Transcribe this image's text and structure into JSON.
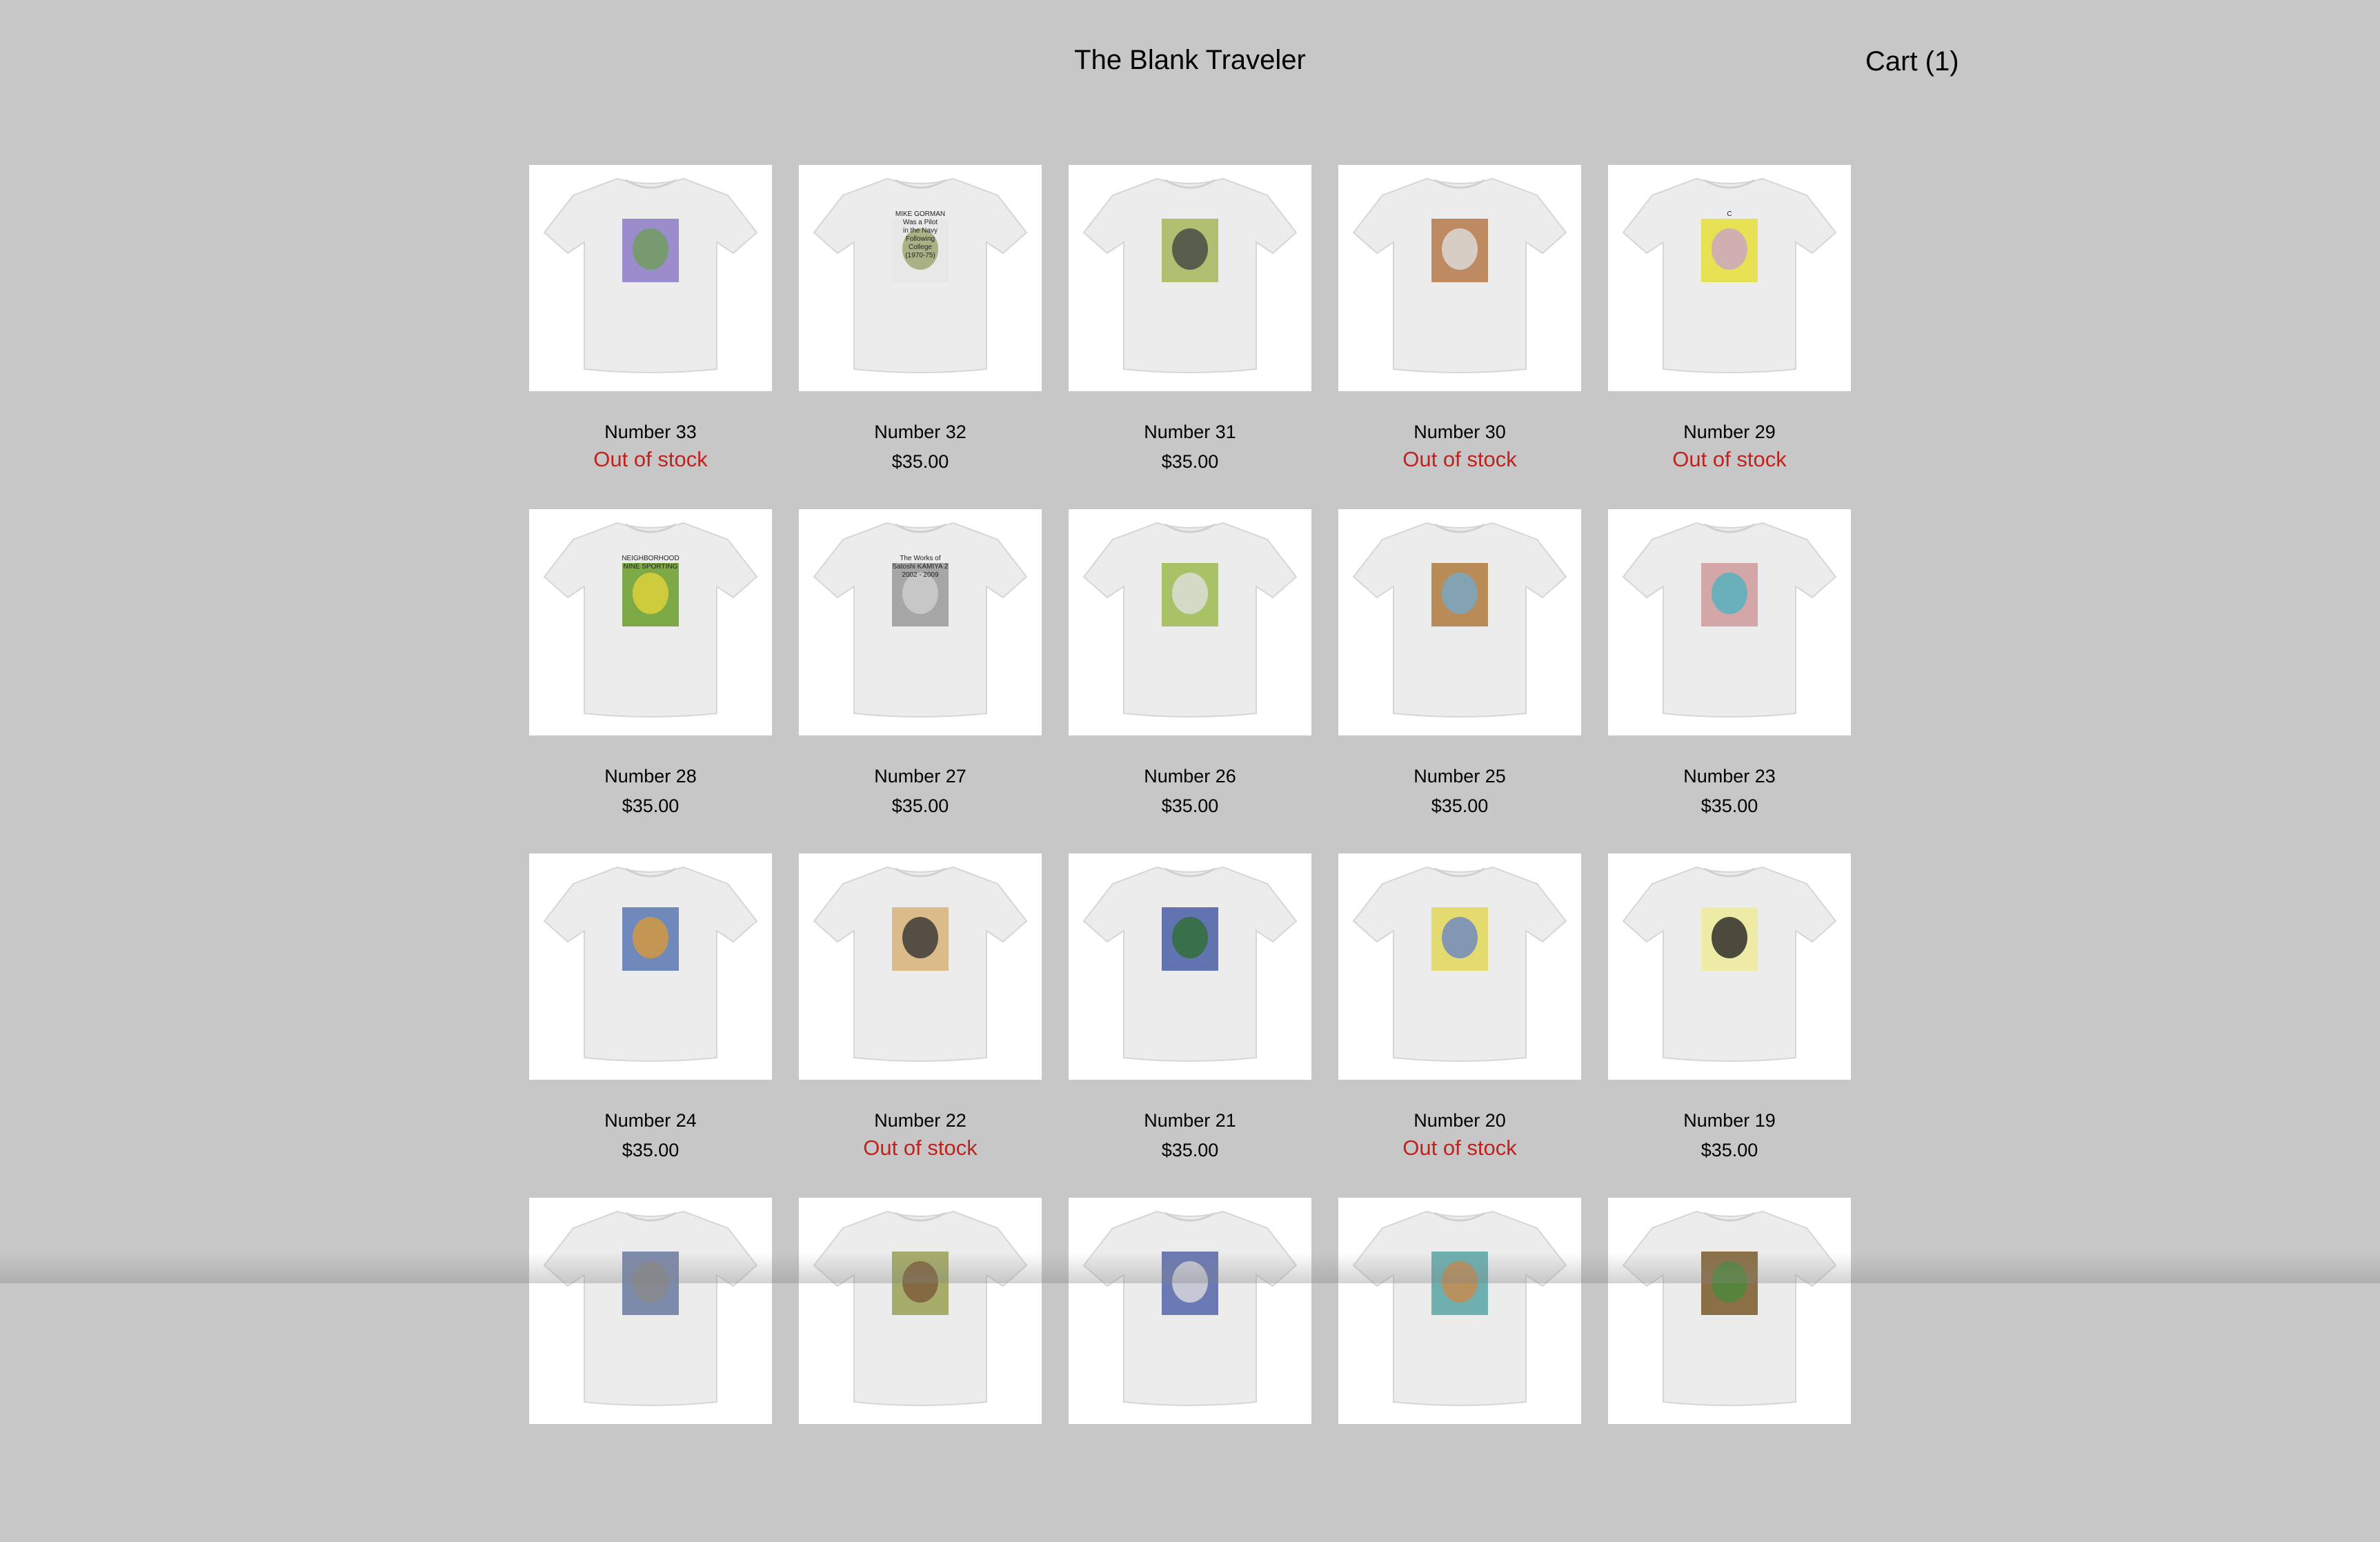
{
  "header": {
    "title": "The Blank Traveler",
    "cart_label": "Cart (1)"
  },
  "colors": {
    "page_background": "#c7c7c7",
    "card_background": "#ffffff",
    "out_of_stock": "#c0231d",
    "text": "#000000"
  },
  "products": [
    {
      "name": "Number 33",
      "price": "Out of stock",
      "sold_out": true,
      "graphic": "purple-figure-print"
    },
    {
      "name": "Number 32",
      "price": "$35.00",
      "sold_out": false,
      "graphic": "mike-gorman-text-print",
      "print_text": [
        "MIKE GORMAN",
        "Was a Pilot",
        "in the Navy",
        "Following",
        "College",
        "(1970-75)"
      ]
    },
    {
      "name": "Number 31",
      "price": "$35.00",
      "sold_out": false,
      "graphic": "green-badge-bird-print"
    },
    {
      "name": "Number 30",
      "price": "Out of stock",
      "sold_out": true,
      "graphic": "copper-shield-print"
    },
    {
      "name": "Number 29",
      "price": "Out of stock",
      "sold_out": true,
      "graphic": "yellow-hexagon-c-print",
      "print_text": [
        "C"
      ]
    },
    {
      "name": "Number 28",
      "price": "$35.00",
      "sold_out": false,
      "graphic": "neighborhood-sporting-print",
      "print_text": [
        "NEIGHBORHOOD",
        "NINE SPORTING"
      ]
    },
    {
      "name": "Number 27",
      "price": "$35.00",
      "sold_out": false,
      "graphic": "satoshi-kamiya-print",
      "print_text": [
        "The Works of",
        "Satoshi KAMIYA 2",
        "2002 - 2009"
      ]
    },
    {
      "name": "Number 26",
      "price": "$35.00",
      "sold_out": false,
      "graphic": "sketch-shield-print"
    },
    {
      "name": "Number 25",
      "price": "$35.00",
      "sold_out": false,
      "graphic": "oval-scene-print"
    },
    {
      "name": "Number 23",
      "price": "$35.00",
      "sold_out": false,
      "graphic": "portrait-bag-print"
    },
    {
      "name": "Number 24",
      "price": "$35.00",
      "sold_out": false,
      "graphic": "sofa-scene-print"
    },
    {
      "name": "Number 22",
      "price": "Out of stock",
      "sold_out": true,
      "graphic": "book-portraits-print"
    },
    {
      "name": "Number 21",
      "price": "$35.00",
      "sold_out": false,
      "graphic": "sailboat-print"
    },
    {
      "name": "Number 20",
      "price": "Out of stock",
      "sold_out": true,
      "graphic": "soldiers-path-print"
    },
    {
      "name": "Number 19",
      "price": "$35.00",
      "sold_out": false,
      "graphic": "sunburst-skull-print"
    },
    {
      "name": "",
      "price": "",
      "sold_out": false,
      "graphic": "group-photo-print"
    },
    {
      "name": "",
      "price": "",
      "sold_out": false,
      "graphic": "frame-figure-print"
    },
    {
      "name": "",
      "price": "",
      "sold_out": false,
      "graphic": "blue-square-print"
    },
    {
      "name": "",
      "price": "",
      "sold_out": false,
      "graphic": "teal-photo-print"
    },
    {
      "name": "",
      "price": "",
      "sold_out": false,
      "graphic": "round-emblem-print"
    }
  ]
}
